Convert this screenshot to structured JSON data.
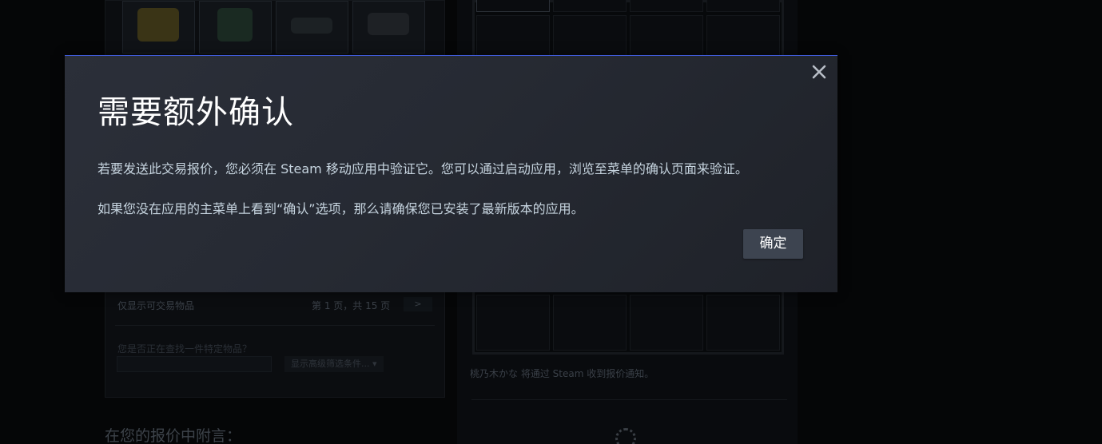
{
  "background": {
    "left_panel": {
      "tradable_only_label": "仅显示可交易物品",
      "pager_text": "第 1 页，共 15 页",
      "next_page": ">",
      "search_prompt": "您是否正在查找一件特定物品？",
      "advanced_filter_label": "显示高级筛选条件...",
      "advanced_filter_icon": "chevron-down-icon"
    },
    "right_panel": {
      "notify_text": "桃乃木かな 将通过 Steam 收到报价通知。"
    },
    "note_title": "在您的报价中附言："
  },
  "modal": {
    "title": "需要额外确认",
    "paragraph1": "若要发送此交易报价，您必须在 Steam 移动应用中验证它。您可以通过启动应用，浏览至菜单的确认页面来验证。",
    "paragraph2": "如果您没在应用的主菜单上看到“确认”选项，那么请确保您已安装了最新版本的应用。",
    "ok_label": "确定",
    "close_icon": "close-icon",
    "accent_color": "#3f5ad6",
    "text_color": "#c6d4df"
  }
}
